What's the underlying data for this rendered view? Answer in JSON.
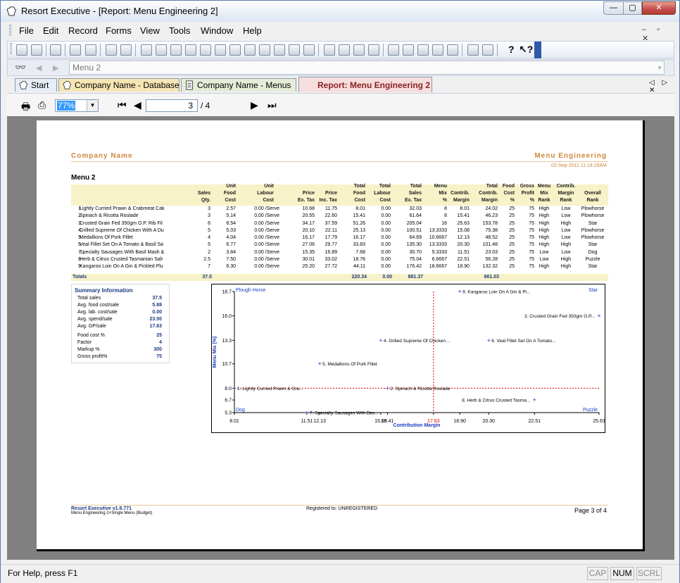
{
  "window": {
    "title": "Resort Executive - [Report: Menu Engineering 2]",
    "min": "—",
    "max": "▢",
    "close": "✕"
  },
  "menu": [
    "File",
    "Edit",
    "Record",
    "Forms",
    "View",
    "Tools",
    "Window",
    "Help"
  ],
  "address": {
    "value": "Menu 2"
  },
  "tabs": [
    {
      "label": "Start"
    },
    {
      "label": "Company Name - Database"
    },
    {
      "label": "Company Name - Menus"
    },
    {
      "label": "Report: Menu Engineering 2"
    }
  ],
  "reportbar": {
    "zoom": "77%",
    "page": "3",
    "of": "/ 4"
  },
  "report": {
    "company": "Company Name",
    "title": "Menu Engineering",
    "date": "02-Sep-2011  11:14:29AM",
    "menu": "Menu 2",
    "col_headers": [
      "Sales\nQty.",
      "Unit\nFood\nCost",
      "Unit\nLabour\nCost",
      "Price\nEx. Tax",
      "Price\nInc. Tax",
      "Total\nFood\nCost",
      "Total\nLabour\nCost",
      "Total\nSales\nEx. Tax",
      "Menu\nMix\n%",
      "Contrib.\nMargin",
      "Total\nContrib.\nMargin",
      "Food\nCost\n%",
      "Gross\nProfit\n%",
      "Menu\nMix\nRank",
      "Contrib.\nMargin\nRank",
      "Overall\nRank"
    ],
    "rows": [
      [
        "1",
        "Lightly Curried Prawn & Crabmeat Cak",
        "3",
        "2.57",
        "0.00 /Serve",
        "10.68",
        "11.75",
        "8.01",
        "0.00",
        "32.03",
        "8",
        "8.01",
        "24.02",
        "25",
        "75",
        "High",
        "Low",
        "Plowhorse"
      ],
      [
        "2",
        "Spinach & Ricotta Roulade",
        "3",
        "5.14",
        "0.00 /Serve",
        "20.55",
        "22.60",
        "15.41",
        "0.00",
        "61.64",
        "8",
        "15.41",
        "46.23",
        "25",
        "75",
        "High",
        "Low",
        "Plowhorse"
      ],
      [
        "3",
        "Crusted Grain Fed 350gm O.P. Rib Fil",
        "6",
        "8.54",
        "0.00 /Serve",
        "34.17",
        "37.59",
        "51.26",
        "0.00",
        "205.04",
        "16",
        "25.63",
        "153.78",
        "25",
        "75",
        "High",
        "High",
        "Star"
      ],
      [
        "4",
        "Grilled Supreme Of Chicken With A Du",
        "5",
        "5.03",
        "0.00 /Serve",
        "20.10",
        "22.11",
        "25.13",
        "0.00",
        "100.51",
        "13.3333",
        "15.08",
        "75.38",
        "25",
        "75",
        "High",
        "Low",
        "Plowhorse"
      ],
      [
        "5",
        "Medallions Of Pork Fillet",
        "4",
        "4.04",
        "0.00 /Serve",
        "16.17",
        "17.79",
        "16.17",
        "0.00",
        "64.69",
        "10.6667",
        "12.13",
        "48.52",
        "25",
        "75",
        "High",
        "Low",
        "Plowhorse"
      ],
      [
        "6",
        "Veal Fillet Set On A Tomato & Basil Sa",
        "5",
        "6.77",
        "0.00 /Serve",
        "27.06",
        "29.77",
        "33.83",
        "0.00",
        "135.30",
        "13.3333",
        "20.30",
        "101.48",
        "25",
        "75",
        "High",
        "High",
        "Star"
      ],
      [
        "7",
        "Specialty Sausages With Basil Mash &",
        "2",
        "3.84",
        "0.00 /Serve",
        "15.35",
        "16.89",
        "7.68",
        "0.00",
        "30.70",
        "5.3333",
        "11.51",
        "23.03",
        "25",
        "75",
        "Low",
        "Low",
        "Dog"
      ],
      [
        "8",
        "Herb & Citrus Crusted Tasmanian Salr",
        "2.5",
        "7.50",
        "0.00 /Serve",
        "30.01",
        "33.02",
        "18.76",
        "0.00",
        "75.04",
        "6.6667",
        "22.51",
        "56.28",
        "25",
        "75",
        "Low",
        "High",
        "Puzzle"
      ],
      [
        "9",
        "Kangaroo Loin On A Gin & Pickled Plu",
        "7",
        "6.30",
        "0.00 /Serve",
        "25.20",
        "27.72",
        "44.11",
        "0.00",
        "176.42",
        "18.6667",
        "18.90",
        "132.32",
        "25",
        "75",
        "High",
        "High",
        "Star"
      ]
    ],
    "totals": {
      "label": "Totals",
      "qty": "37.5",
      "food": "220.34",
      "labour": "0.00",
      "sales": "881.37",
      "contrib": "661.03"
    },
    "summary": {
      "title": "Summary Information",
      "items": [
        [
          "Total sales",
          "37.5"
        ],
        [
          "Avg. food cost/sale",
          "5.88"
        ],
        [
          "Avg. lab. cost/sale",
          "0.00"
        ],
        [
          "Avg. spend/sale",
          "23.50"
        ],
        [
          "Avg. GP/sale",
          "17.63"
        ],
        [
          "Food cost %",
          "25"
        ],
        [
          "Factor",
          "4"
        ],
        [
          "Markup %",
          "300"
        ],
        [
          "Gross profit%",
          "75"
        ]
      ]
    },
    "footer": {
      "app": "Resort Executive v1.6.771",
      "sub": "Menu Engineering 2+Single Menu (Budget)",
      "registered": "Registered to: UNREGISTERED",
      "page": "Page 3 of 4"
    }
  },
  "chart_data": {
    "type": "scatter",
    "xlabel": "Contribution Margin",
    "ylabel": "Menu Mix (%)",
    "xticks": [
      "8.01",
      "11.51",
      "12.13",
      "15.08",
      "15.41",
      "17.63",
      "18.90",
      "20.30",
      "22.51",
      "25.63"
    ],
    "yticks": [
      "5.3",
      "6.7",
      "8.0",
      "10.7",
      "13.3",
      "16.0",
      "18.7"
    ],
    "xlim": [
      8.01,
      25.63
    ],
    "ylim": [
      5.3,
      18.7
    ],
    "avg_x": 17.63,
    "avg_y": 8.0,
    "avg_x_label": "17.63",
    "quadrants": {
      "top_left": "Plough Horse",
      "top_right": "Star",
      "bottom_left": "Dog",
      "bottom_right": "Puzzle"
    },
    "points": [
      {
        "x": 8.01,
        "y": 8.0,
        "label": "1. Lightly Curried Prawn & Cra..."
      },
      {
        "x": 15.41,
        "y": 8.0,
        "label": "2. Spinach & Ricotta Roulade"
      },
      {
        "x": 25.63,
        "y": 16.0,
        "label": "3. Crusted Grain Fed 350gm O.P..."
      },
      {
        "x": 15.08,
        "y": 13.3,
        "label": "4. Grilled Supreme Of Chicken ..."
      },
      {
        "x": 12.13,
        "y": 10.7,
        "label": "5. Medallions Of Pork Fillet"
      },
      {
        "x": 20.3,
        "y": 13.3,
        "label": "6. Veal Fillet Set On A Tomato..."
      },
      {
        "x": 11.51,
        "y": 5.3,
        "label": "7. Specialty Sausages With Bas..."
      },
      {
        "x": 22.51,
        "y": 6.7,
        "label": "8. Herb & Citrus Crusted Tasma..."
      },
      {
        "x": 18.9,
        "y": 18.7,
        "label": "9. Kangaroo Loin On A Gin & Pi..."
      }
    ]
  },
  "statusbar": {
    "text": "For Help, press F1",
    "cap": "CAP",
    "num": "NUM",
    "scrl": "SCRL"
  }
}
